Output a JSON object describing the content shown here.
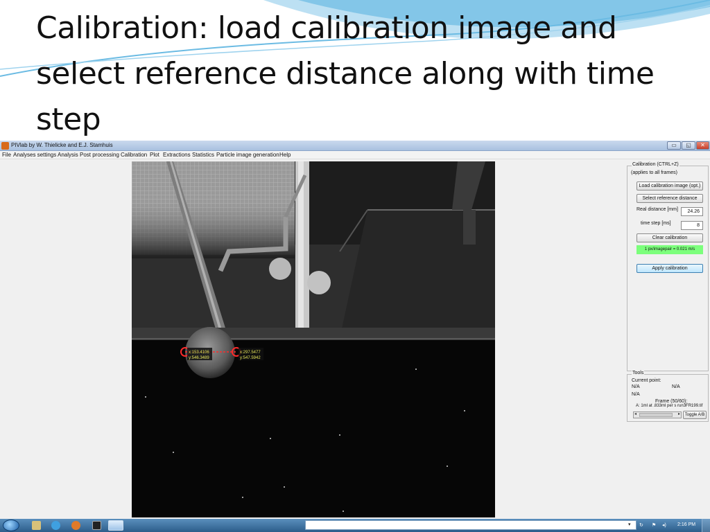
{
  "slide": {
    "title": "Calibration: load calibration image and select reference distance along with time step"
  },
  "window": {
    "title": "PIVlab by W. Thielicke and E.J. Stamhuis",
    "controls": {
      "minimize": "▭",
      "maximize": "◱",
      "close": "✕"
    }
  },
  "menu": {
    "items": [
      "File",
      "Analyses settings",
      "Analysis",
      "Post processing",
      "Calibration",
      "Plot",
      "Extractions",
      "Statistics",
      "Particle image generation",
      "Help"
    ]
  },
  "image_annotations": {
    "point1_x": "x:153.4106",
    "point1_y": "y:546.3489",
    "point2_x": "x:297.5477",
    "point2_y": "y:547.5942"
  },
  "calibration_panel": {
    "legend": "Calibration (CTRL+Z)",
    "note": "(applies to all frames)",
    "load_button": "Load calibration image (opt.)",
    "select_button": "Select reference distance",
    "real_distance_label": "Real distance [mm]",
    "real_distance_value": "24.26",
    "time_step_label": "time step [ms]",
    "time_step_value": "8",
    "clear_button": "Clear calibration",
    "status_text": "1 px/imagepair = 0.021 m/s",
    "apply_button": "Apply calibration"
  },
  "tools_panel": {
    "legend": "Tools",
    "current_point_label": "Current point:",
    "current_point_x": "N/A",
    "current_point_y": "N/A",
    "current_point_z": "N/A",
    "frame_text": "Frame (50/60):",
    "file_text": "A: 1ml at .833ml per s run3FR199.tif",
    "toggle_button": "Toggle A/B"
  },
  "taskbar": {
    "clock": "2:16 PM"
  },
  "colors": {
    "status_green": "#7cff7c",
    "marker_red": "#ff2a2a",
    "annotation_yellow": "#e8e85a"
  }
}
